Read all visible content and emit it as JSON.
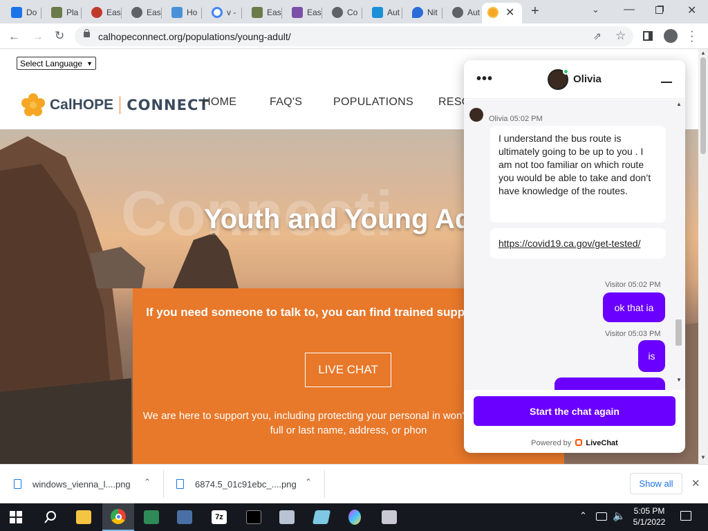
{
  "browser": {
    "tabs": [
      {
        "label": "Do",
        "color": "#1a73e8"
      },
      {
        "label": "Pla",
        "color": "#6b7b4a"
      },
      {
        "label": "Eas",
        "color": "#c0392b"
      },
      {
        "label": "Eas",
        "color": "#5f6368"
      },
      {
        "label": "Ho",
        "color": "#4a90d9"
      },
      {
        "label": "v -",
        "color": "#4285f4"
      },
      {
        "label": "Eas",
        "color": "#6b7b4a"
      },
      {
        "label": "Eas",
        "color": "#7b4ea8"
      },
      {
        "label": "Co",
        "color": "#5f6368"
      },
      {
        "label": "Aut",
        "color": "#1a8fd8"
      },
      {
        "label": "Nit",
        "color": "#2b6cd8"
      },
      {
        "label": "Aut",
        "color": "#5f6368"
      }
    ],
    "url": "calhopeconnect.org/populations/young-adult/"
  },
  "site": {
    "language_select": "Select Language",
    "logo_main": "CalHOPE",
    "logo_sub": "CONNECT",
    "nav": [
      "HOME",
      "FAQ'S",
      "POPULATIONS",
      "RESO"
    ],
    "hero_ghost": "Connecti",
    "hero_title": "Youth and Young Adu",
    "talk_text": "If you need someone to talk to, you can find trained supp chat with here:",
    "live_chat_label": "LIVE CHAT",
    "support_text": "We are here to support you, including protecting your personal in won't be a need for your full or last name, address, or phon"
  },
  "chat": {
    "agent_name": "Olivia",
    "agent_meta": "Olivia 05:02 PM",
    "agent_message": "I understand the bus route is ultimately going to be up to you . I am not too familiar on which route you would be able to take and don’t have knowledge of the routes.",
    "agent_link": "https://covid19.ca.gov/get-tested/",
    "visitor_meta_1": "Visitor 05:02 PM",
    "visitor_message_1": "ok that ia",
    "visitor_meta_2": "Visitor 05:03 PM",
    "visitor_message_2": "is",
    "restart_label": "Start the chat again",
    "powered_by": "Powered by",
    "brand": "LiveChat",
    "accent": "#6a00ff"
  },
  "downloads": {
    "items": [
      "windows_vienna_l....png",
      "6874.5_01c91ebc_....png"
    ],
    "show_all": "Show all"
  },
  "taskbar": {
    "time": "5:05 PM",
    "date": "5/1/2022"
  }
}
